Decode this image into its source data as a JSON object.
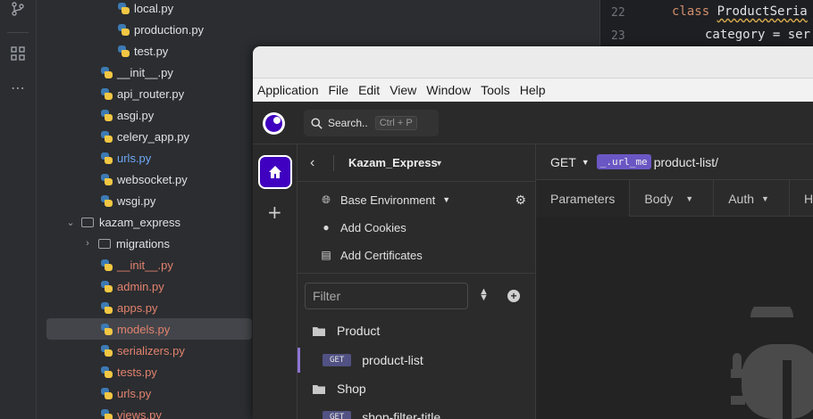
{
  "tree": {
    "items": [
      {
        "label": "local.py",
        "color": "normal"
      },
      {
        "label": "production.py",
        "color": "normal"
      },
      {
        "label": "test.py",
        "color": "normal"
      },
      {
        "label": "__init__.py",
        "color": "normal"
      },
      {
        "label": "api_router.py",
        "color": "normal"
      },
      {
        "label": "asgi.py",
        "color": "normal"
      },
      {
        "label": "celery_app.py",
        "color": "normal"
      },
      {
        "label": "urls.py",
        "color": "blue"
      },
      {
        "label": "websocket.py",
        "color": "normal"
      },
      {
        "label": "wsgi.py",
        "color": "normal"
      },
      {
        "label": "kazam_express",
        "color": "normal"
      },
      {
        "label": "migrations",
        "color": "normal"
      },
      {
        "label": "__init__.py",
        "color": "red"
      },
      {
        "label": "admin.py",
        "color": "red"
      },
      {
        "label": "apps.py",
        "color": "red"
      },
      {
        "label": "models.py",
        "color": "red"
      },
      {
        "label": "serializers.py",
        "color": "red"
      },
      {
        "label": "tests.py",
        "color": "red"
      },
      {
        "label": "urls.py",
        "color": "red"
      },
      {
        "label": "views.py",
        "color": "red"
      }
    ]
  },
  "editor": {
    "lines": [
      {
        "num": "22",
        "keyword": "class",
        "text": "ProductSeria"
      },
      {
        "num": "23",
        "keyword": "",
        "text": "category = ser"
      }
    ]
  },
  "app": {
    "menu": [
      "Application",
      "File",
      "Edit",
      "View",
      "Window",
      "Tools",
      "Help"
    ],
    "search_label": "Search..",
    "search_shortcut": "Ctrl + P",
    "project_name": "Kazam_Express",
    "environment": "Base Environment",
    "add_cookies": "Add Cookies",
    "add_certificates": "Add Certificates",
    "filter_placeholder": "Filter",
    "folders": [
      {
        "name": "Product",
        "requests": [
          {
            "method": "GET",
            "name": "product-list",
            "active": true
          }
        ]
      },
      {
        "name": "Shop",
        "requests": [
          {
            "method": "GET",
            "name": "shop-filter-title",
            "active": false
          }
        ]
      }
    ],
    "request": {
      "method": "GET",
      "env_tag": "_.url_me",
      "path": "product-list/"
    },
    "tabs": [
      "Parameters",
      "Body",
      "Auth",
      "H"
    ],
    "accent": "#4000bf"
  }
}
